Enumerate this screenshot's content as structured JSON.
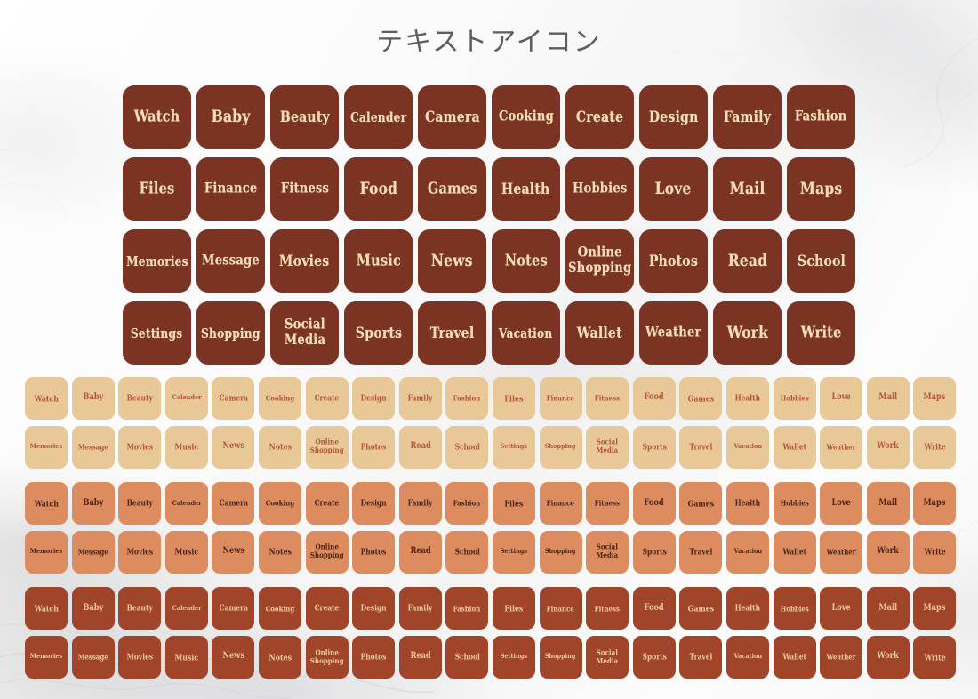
{
  "page": {
    "title": "テキストアイコン",
    "title_romaji_meaning": "Text Icon",
    "background": "white-marble"
  },
  "colors": {
    "big_tile_bg": "#7b3423",
    "big_tile_text": "#f5ddb6",
    "band_tan_bg": "#e9c898",
    "band_tan_text": "#b65434",
    "band_salmon_bg": "#dd8c5f",
    "band_salmon_text": "#4a2414",
    "band_brick_bg": "#a0452a",
    "band_brick_text": "#eccaa0",
    "page_bg": "#fbfbfb",
    "title_text": "#5d5d5d"
  },
  "big_grid": {
    "columns": 10,
    "rows": 4,
    "tiles": [
      {
        "label": "Watch",
        "name": "watch"
      },
      {
        "label": "Baby",
        "name": "baby"
      },
      {
        "label": "Beauty",
        "name": "beauty"
      },
      {
        "label": "Calender",
        "name": "calender"
      },
      {
        "label": "Camera",
        "name": "camera"
      },
      {
        "label": "Cooking",
        "name": "cooking"
      },
      {
        "label": "Create",
        "name": "create"
      },
      {
        "label": "Design",
        "name": "design"
      },
      {
        "label": "Family",
        "name": "family"
      },
      {
        "label": "Fashion",
        "name": "fashion"
      },
      {
        "label": "Files",
        "name": "files"
      },
      {
        "label": "Finance",
        "name": "finance"
      },
      {
        "label": "Fitness",
        "name": "fitness"
      },
      {
        "label": "Food",
        "name": "food"
      },
      {
        "label": "Games",
        "name": "games"
      },
      {
        "label": "Health",
        "name": "health"
      },
      {
        "label": "Hobbies",
        "name": "hobbies"
      },
      {
        "label": "Love",
        "name": "love"
      },
      {
        "label": "Mail",
        "name": "mail"
      },
      {
        "label": "Maps",
        "name": "maps"
      },
      {
        "label": "Memories",
        "name": "memories"
      },
      {
        "label": "Message",
        "name": "message"
      },
      {
        "label": "Movies",
        "name": "movies"
      },
      {
        "label": "Music",
        "name": "music"
      },
      {
        "label": "News",
        "name": "news"
      },
      {
        "label": "Notes",
        "name": "notes"
      },
      {
        "label": "Online\nShopping",
        "name": "online-shopping",
        "two_line": true
      },
      {
        "label": "Photos",
        "name": "photos"
      },
      {
        "label": "Read",
        "name": "read"
      },
      {
        "label": "School",
        "name": "school"
      },
      {
        "label": "Settings",
        "name": "settings"
      },
      {
        "label": "Shopping",
        "name": "shopping"
      },
      {
        "label": "Social\nMedia",
        "name": "social-media",
        "two_line": true
      },
      {
        "label": "Sports",
        "name": "sports"
      },
      {
        "label": "Travel",
        "name": "travel"
      },
      {
        "label": "Vacation",
        "name": "vacation"
      },
      {
        "label": "Wallet",
        "name": "wallet"
      },
      {
        "label": "Weather",
        "name": "weather"
      },
      {
        "label": "Work",
        "name": "work"
      },
      {
        "label": "Write",
        "name": "write"
      }
    ]
  },
  "small_bands": [
    {
      "name": "tan",
      "style": "band-tan",
      "bg": "#e9c898",
      "text": "#b65434"
    },
    {
      "name": "salmon",
      "style": "band-salmon",
      "bg": "#dd8c5f",
      "text": "#4a2414"
    },
    {
      "name": "brick",
      "style": "band-brick",
      "bg": "#a0452a",
      "text": "#eccaa0"
    }
  ],
  "small_grid": {
    "columns": 20,
    "rows_per_band": 2,
    "row_1": [
      {
        "label": "Watch",
        "name": "watch"
      },
      {
        "label": "Baby",
        "name": "baby"
      },
      {
        "label": "Beauty",
        "name": "beauty"
      },
      {
        "label": "Calender",
        "name": "calender"
      },
      {
        "label": "Camera",
        "name": "camera"
      },
      {
        "label": "Cooking",
        "name": "cooking"
      },
      {
        "label": "Create",
        "name": "create"
      },
      {
        "label": "Design",
        "name": "design"
      },
      {
        "label": "Family",
        "name": "family"
      },
      {
        "label": "Fashion",
        "name": "fashion"
      },
      {
        "label": "Files",
        "name": "files"
      },
      {
        "label": "Finance",
        "name": "finance"
      },
      {
        "label": "Fitness",
        "name": "fitness"
      },
      {
        "label": "Food",
        "name": "food"
      },
      {
        "label": "Games",
        "name": "games"
      },
      {
        "label": "Health",
        "name": "health"
      },
      {
        "label": "Hobbies",
        "name": "hobbies"
      },
      {
        "label": "Love",
        "name": "love"
      },
      {
        "label": "Mail",
        "name": "mail"
      },
      {
        "label": "Maps",
        "name": "maps"
      }
    ],
    "row_2": [
      {
        "label": "Memories",
        "name": "memories"
      },
      {
        "label": "Message",
        "name": "message"
      },
      {
        "label": "Movies",
        "name": "movies"
      },
      {
        "label": "Music",
        "name": "music"
      },
      {
        "label": "News",
        "name": "news"
      },
      {
        "label": "Notes",
        "name": "notes"
      },
      {
        "label": "Online\nShopping",
        "name": "online-shopping",
        "two_line": true
      },
      {
        "label": "Photos",
        "name": "photos"
      },
      {
        "label": "Read",
        "name": "read"
      },
      {
        "label": "School",
        "name": "school"
      },
      {
        "label": "Settings",
        "name": "settings"
      },
      {
        "label": "Shopping",
        "name": "shopping"
      },
      {
        "label": "Social\nMedia",
        "name": "social-media",
        "two_line": true
      },
      {
        "label": "Sports",
        "name": "sports"
      },
      {
        "label": "Travel",
        "name": "travel"
      },
      {
        "label": "Vacation",
        "name": "vacation"
      },
      {
        "label": "Wallet",
        "name": "wallet"
      },
      {
        "label": "Weather",
        "name": "weather"
      },
      {
        "label": "Work",
        "name": "work"
      },
      {
        "label": "Write",
        "name": "write"
      }
    ]
  }
}
